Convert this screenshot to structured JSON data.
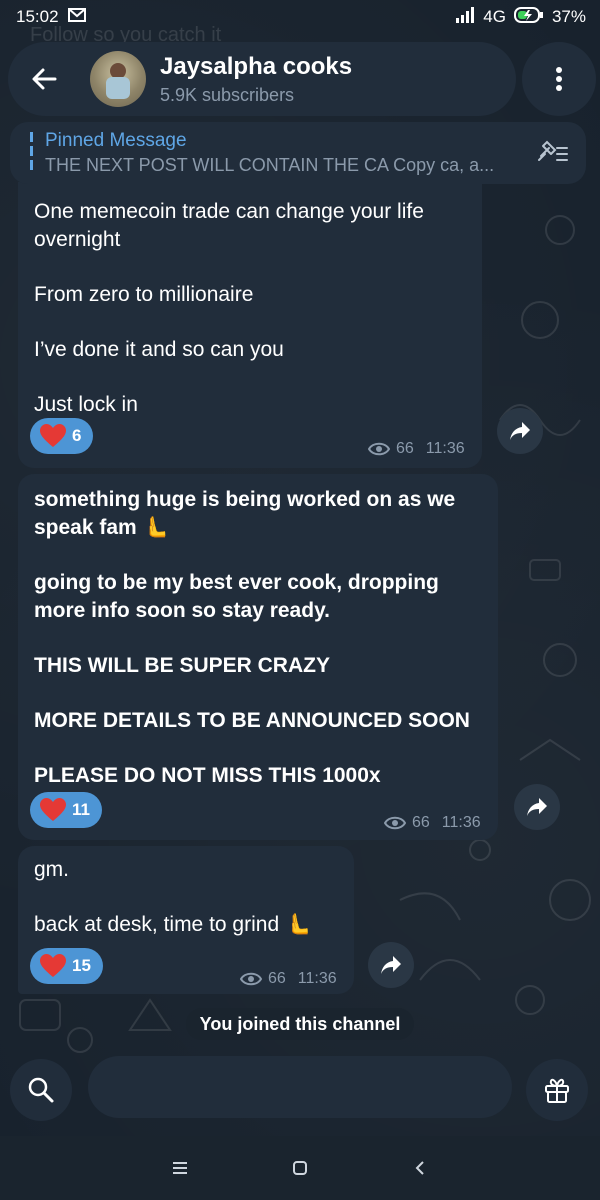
{
  "status_bar": {
    "time": "15:02",
    "network": "4G",
    "battery": "37%",
    "icons": [
      "gmail-icon",
      "signal-icon",
      "battery-charging-icon"
    ]
  },
  "background_ghost_text": "Follow so you catch it",
  "header": {
    "channel_name": "Jaysalpha cooks",
    "subscribers": "5.9K subscribers"
  },
  "pinned": {
    "title": "Pinned Message",
    "preview": "THE NEXT POST WILL CONTAIN THE CA  Copy ca, a..."
  },
  "messages": [
    {
      "lines": [
        "One memecoin trade can change your life",
        "overnight",
        "",
        "From zero to millionaire",
        "",
        "I’ve done it and so can you",
        "",
        "Just lock in"
      ],
      "bold": false,
      "reaction": {
        "emoji": "heart",
        "count": "6"
      },
      "views": "66",
      "time": "11:36"
    },
    {
      "lines": [
        "something huge is being worked on as we",
        "speak fam 🫷",
        "",
        "going to be my best ever cook, dropping",
        "more info soon so stay ready.",
        "",
        "THIS WILL BE SUPER CRAZY",
        "",
        "MORE DETAILS TO BE ANNOUNCED SOON",
        "",
        "PLEASE DO NOT MISS THIS 1000x"
      ],
      "bold": true,
      "reaction": {
        "emoji": "heart",
        "count": "11"
      },
      "views": "66",
      "time": "11:36"
    },
    {
      "lines": [
        "gm.",
        "",
        "back at desk, time to grind 🫷"
      ],
      "bold": false,
      "reaction": {
        "emoji": "heart",
        "count": "15"
      },
      "views": "66",
      "time": "11:36"
    }
  ],
  "service_message": "You joined this channel",
  "input": {
    "value": "",
    "placeholder": ""
  },
  "colors": {
    "background": "#18222d",
    "bubble": "#212d3b",
    "accent": "#5fa6e6",
    "reaction": "#4d95d5",
    "heart": "#e53935",
    "muted": "#8b9aab"
  }
}
